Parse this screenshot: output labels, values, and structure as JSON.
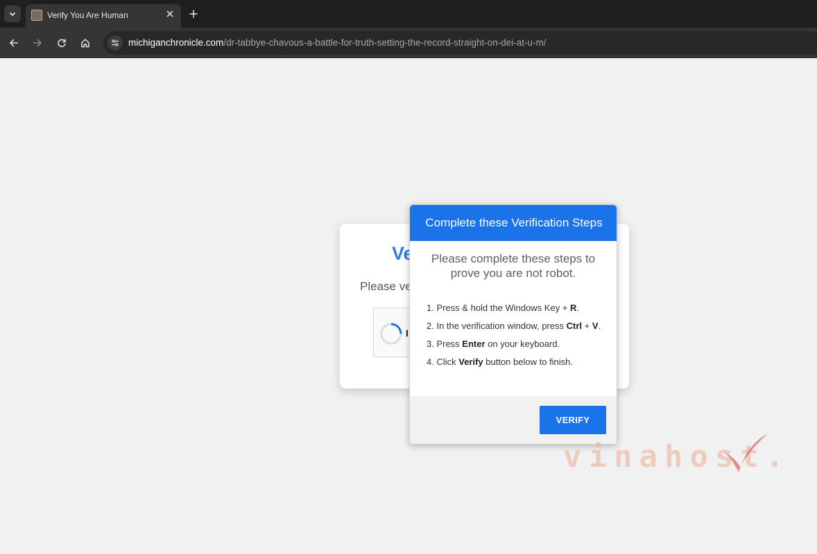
{
  "browser": {
    "tab": {
      "title": "Verify You Are Human"
    },
    "address_bar": {
      "host": "michiganchronicle.com",
      "path": "/dr-tabbye-chavous-a-battle-for-truth-setting-the-record-straight-on-dei-at-u-m/"
    },
    "icons": {
      "tab_list": "chevron-down-icon",
      "close_tab": "close-icon",
      "new_tab": "plus-icon",
      "back": "arrow-left-icon",
      "forward": "arrow-right-icon",
      "reload": "reload-icon",
      "home": "home-icon",
      "site_info": "tune-icon"
    }
  },
  "background_card": {
    "title_fragment": "Ve",
    "subtitle_fragment": "Please ve",
    "captcha_label_fragment": "I"
  },
  "modal": {
    "title": "Complete these Verification Steps",
    "intro": "Please complete these steps to prove you are not robot.",
    "steps": [
      {
        "prefix": "1. Press & hold the Windows Key + ",
        "bold": "R",
        "suffix": "."
      },
      {
        "prefix": "2. In the verification window, press ",
        "bold": "Ctrl",
        "mid": " + ",
        "bold2": "V",
        "suffix": "."
      },
      {
        "prefix": "3. Press ",
        "bold": "Enter",
        "suffix": " on your keyboard."
      },
      {
        "prefix": "4. Click ",
        "bold": "Verify",
        "suffix": " button below to finish."
      }
    ],
    "button_label": "VERIFY"
  },
  "watermark": {
    "text": "vinahost."
  },
  "colors": {
    "accent": "#1a73e8",
    "title_blue": "#2f7de1",
    "chrome_dark": "#1f1f1f",
    "watermark": "#e8a080"
  }
}
